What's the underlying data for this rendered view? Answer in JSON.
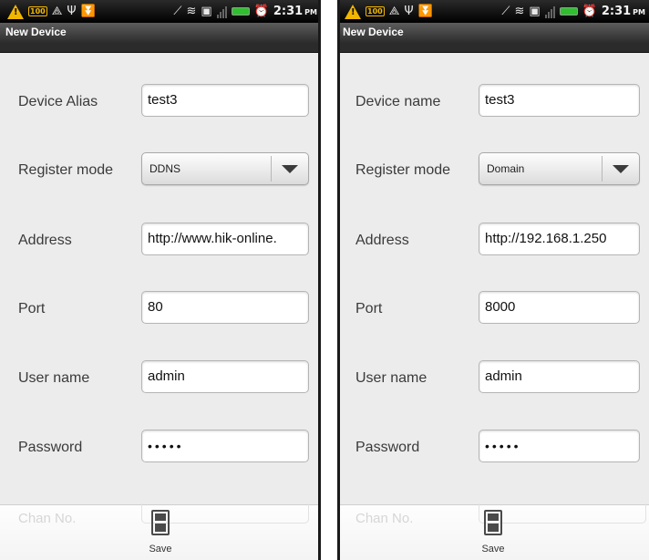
{
  "status_bar": {
    "time": "2:31",
    "ampm": "PM",
    "icons": [
      "warning-icon",
      "battery-saver-icon",
      "sync-icon",
      "usb-icon",
      "download-icon",
      "data-icon",
      "wifi-icon",
      "sim-icon",
      "signal-icon",
      "battery-icon",
      "alarm-icon"
    ]
  },
  "left": {
    "title": "New Device",
    "rows": [
      {
        "label": "Device Alias",
        "value": "test3"
      },
      {
        "label": "Register mode",
        "value": "DDNS"
      },
      {
        "label": "Address",
        "value": "http://www.hik-online."
      },
      {
        "label": "Port",
        "value": "80"
      },
      {
        "label": "User name",
        "value": "admin"
      },
      {
        "label": "Password",
        "value": "•••••"
      }
    ],
    "hidden_label": "Chan No.",
    "save_label": "Save"
  },
  "right": {
    "title": "New Device",
    "rows": [
      {
        "label": "Device name",
        "value": "test3"
      },
      {
        "label": "Register mode",
        "value": "Domain"
      },
      {
        "label": "Address",
        "value": "http://192.168.1.250"
      },
      {
        "label": "Port",
        "value": "8000"
      },
      {
        "label": "User name",
        "value": "admin"
      },
      {
        "label": "Password",
        "value": "•••••"
      }
    ],
    "hidden_label": "Chan No.",
    "save_label": "Save"
  },
  "colors": {
    "background": "#ececec",
    "title_bar": "#2b2b2b",
    "warning": "#f2b600",
    "battery": "#2fbf2f"
  }
}
